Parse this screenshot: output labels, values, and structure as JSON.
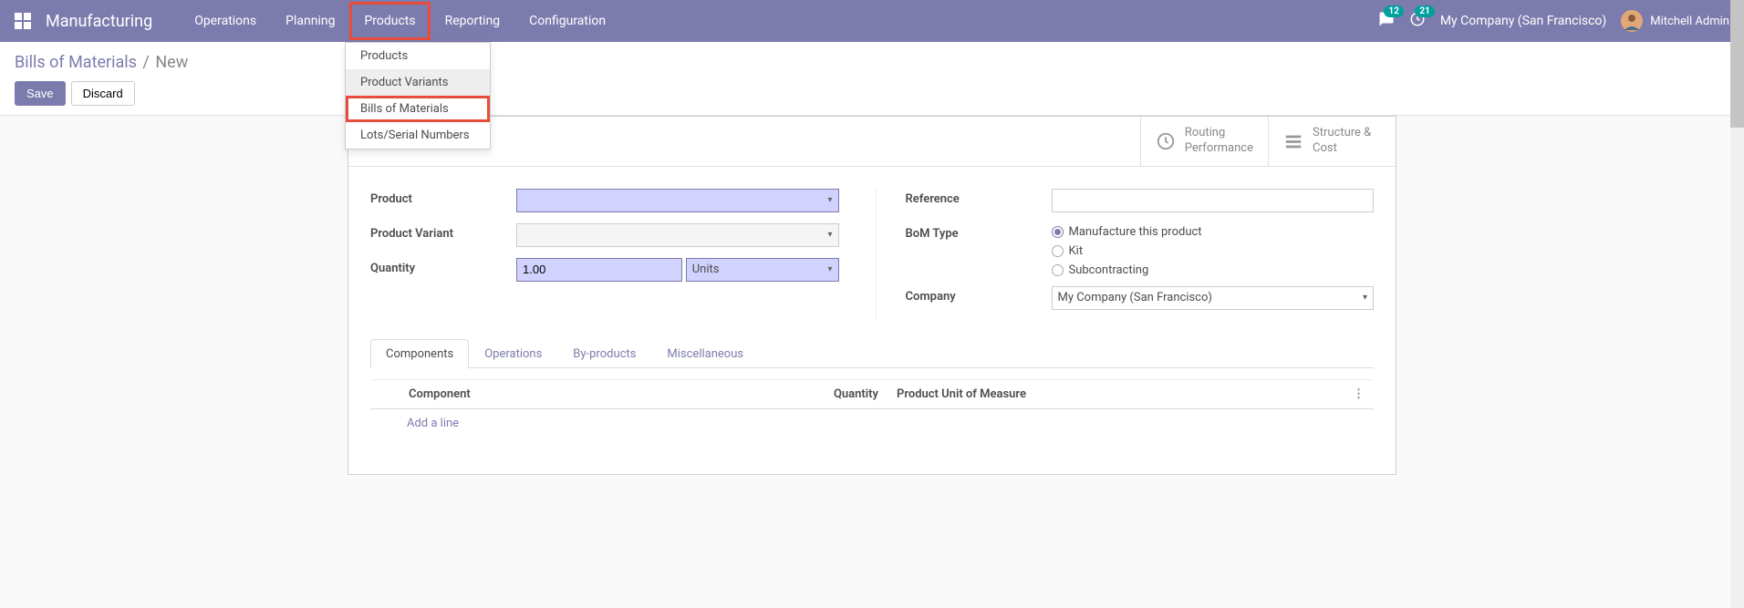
{
  "navbar": {
    "brand": "Manufacturing",
    "menu": [
      "Operations",
      "Planning",
      "Products",
      "Reporting",
      "Configuration"
    ],
    "highlighted_menu_index": 2,
    "messages_badge": "12",
    "activities_badge": "21",
    "company": "My Company (San Francisco)",
    "user_name": "Mitchell Admin"
  },
  "dropdown": {
    "items": [
      "Products",
      "Product Variants",
      "Bills of Materials",
      "Lots/Serial Numbers"
    ],
    "highlighted_index": 2,
    "hover_index": 1
  },
  "breadcrumb": {
    "root": "Bills of Materials",
    "active": "New"
  },
  "buttons": {
    "save": "Save",
    "discard": "Discard"
  },
  "stat_buttons": {
    "routing_l1": "Routing",
    "routing_l2": "Performance",
    "structure_l1": "Structure &",
    "structure_l2": "Cost"
  },
  "form": {
    "left": {
      "product_label": "Product",
      "product_value": "",
      "variant_label": "Product Variant",
      "variant_value": "",
      "quantity_label": "Quantity",
      "quantity_value": "1.00",
      "quantity_unit": "Units"
    },
    "right": {
      "reference_label": "Reference",
      "reference_value": "",
      "bom_type_label": "BoM Type",
      "bom_options": [
        "Manufacture this product",
        "Kit",
        "Subcontracting"
      ],
      "bom_selected_index": 0,
      "company_label": "Company",
      "company_value": "My Company (San Francisco)"
    }
  },
  "tabs": {
    "items": [
      "Components",
      "Operations",
      "By-products",
      "Miscellaneous"
    ],
    "active_index": 0
  },
  "table": {
    "headers": {
      "component": "Component",
      "quantity": "Quantity",
      "uom": "Product Unit of Measure"
    },
    "add_line": "Add a line"
  }
}
